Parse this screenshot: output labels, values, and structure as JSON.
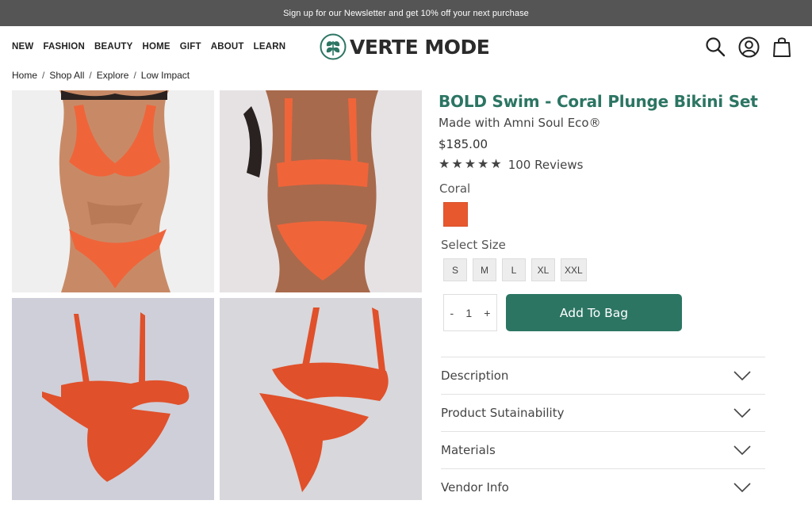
{
  "promo": {
    "text": "Sign up for our Newsletter and get 10% off your next purchase"
  },
  "nav": {
    "items": [
      "NEW",
      "FASHION",
      "BEAUTY",
      "HOME",
      "GIFT",
      "ABOUT",
      "LEARN"
    ]
  },
  "brand": {
    "name": "VERTE MODE",
    "accent": "#2c7563"
  },
  "header_icons": [
    "search-icon",
    "account-icon",
    "bag-icon"
  ],
  "breadcrumb": [
    "Home",
    "Shop All",
    "Explore",
    "Low Impact"
  ],
  "product": {
    "title": "BOLD Swim - Coral Plunge Bikini Set",
    "subtitle": "Made with Amni Soul Eco®",
    "price": "$185.00",
    "rating": 5,
    "reviews": "100 Reviews",
    "color_name": "Coral",
    "swatch_color": "#e8582e",
    "size_label": "Select Size",
    "sizes": [
      "S",
      "M",
      "L",
      "XL",
      "XXL"
    ],
    "quantity": {
      "minus": "-",
      "value": "1",
      "plus": "+"
    },
    "add_button": "Add To Bag"
  },
  "accordion": [
    "Description",
    "Product Sutainability",
    "Materials",
    "Vendor Info"
  ]
}
